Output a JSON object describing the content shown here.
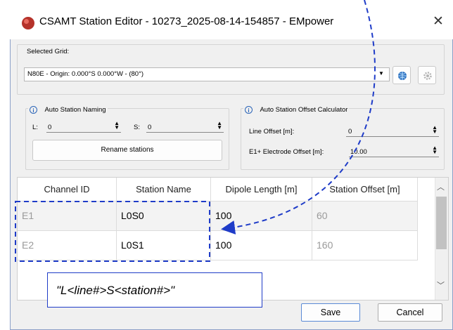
{
  "window": {
    "title": "CSAMT Station Editor - 10273_2025-08-14-154857 - EMpower",
    "close_glyph": "✕"
  },
  "grid": {
    "legend": "Selected Grid:",
    "selected": "N80E - Origin: 0.000°S 0.000°W - (80°)",
    "buttons": [
      "globe-icon",
      "gear-icon"
    ]
  },
  "naming": {
    "legend": "Auto Station Naming",
    "l_label": "L:",
    "l_value": "0",
    "s_label": "S:",
    "s_value": "0",
    "rename_label": "Rename stations"
  },
  "offset": {
    "legend": "Auto Station Offset Calculator",
    "line_offset_label": "Line Offset [m]:",
    "line_offset_value": "0",
    "electrode_label": "E1+ Electrode Offset [m]:",
    "electrode_value": "10.00"
  },
  "table": {
    "headers": [
      "Channel ID",
      "Station Name",
      "Dipole Length [m]",
      "Station Offset [m]"
    ],
    "rows": [
      [
        "E1",
        "L0S0",
        "100",
        "60"
      ],
      [
        "E2",
        "L0S1",
        "100",
        "160"
      ]
    ]
  },
  "annotation": {
    "note": "\"L<line#>S<station#>\"",
    "color": "#1f3cc8"
  },
  "footer": {
    "save_label": "Save",
    "cancel_label": "Cancel"
  }
}
